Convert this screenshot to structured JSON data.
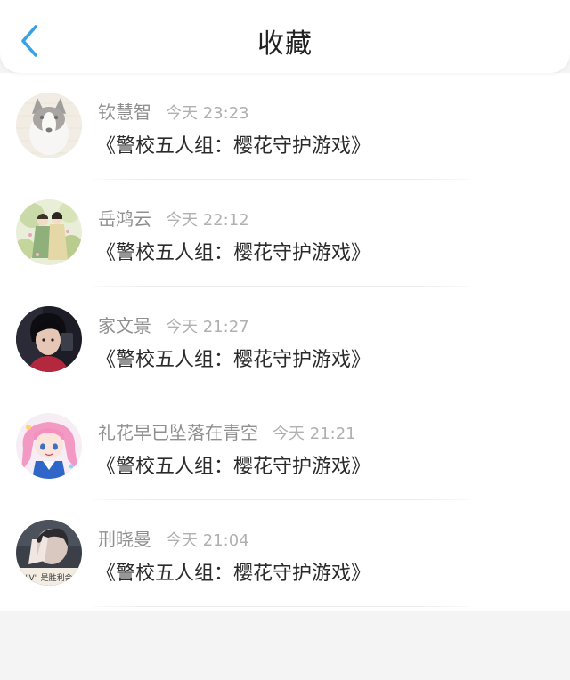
{
  "header": {
    "title": "收藏",
    "back_icon": "chevron-left-icon",
    "accent_color": "#3aa0e6"
  },
  "items": [
    {
      "name": "钦慧智",
      "time": "今天 23:23",
      "book": "《警校五人组：樱花守护游戏》",
      "avatar": "dog-avatar"
    },
    {
      "name": "岳鸿云",
      "time": "今天 22:12",
      "book": "《警校五人组：樱花守护游戏》",
      "avatar": "illustrated-couple-avatar"
    },
    {
      "name": "家文景",
      "time": "今天 21:27",
      "book": "《警校五人组：樱花守护游戏》",
      "avatar": "person-photo-avatar"
    },
    {
      "name": "礼花早已坠落在青空",
      "time": "今天 21:21",
      "book": "《警校五人组：樱花守护游戏》",
      "avatar": "anime-girl-avatar"
    },
    {
      "name": "刑晓曼",
      "time": "今天 21:04",
      "book": "《警校五人组：樱花守护游戏》",
      "avatar": "hand-photo-avatar",
      "avatar_caption": "\"V\" 是胜利会"
    }
  ]
}
